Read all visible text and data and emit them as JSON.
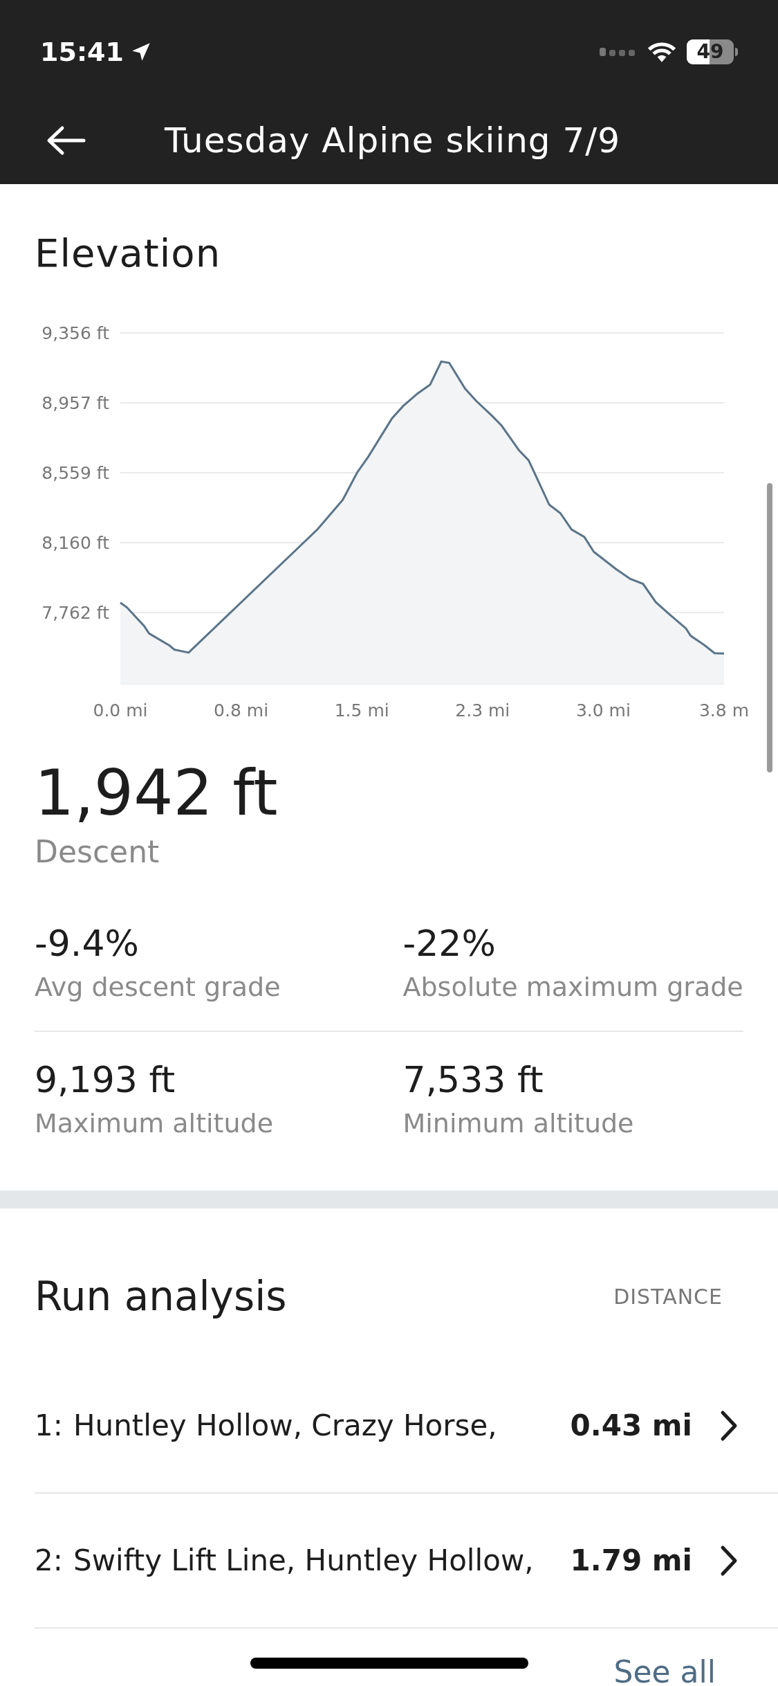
{
  "status_bar": {
    "time": "15:41",
    "battery": "49"
  },
  "header": {
    "title": "Tuesday Alpine skiing 7/9"
  },
  "elevation": {
    "title": "Elevation",
    "chart_data": {
      "type": "area",
      "xlim": [
        0,
        3.8
      ],
      "ylim": [
        7355,
        9356
      ],
      "x": [
        0,
        0.04,
        0.15,
        0.18,
        0.31,
        0.34,
        0.43,
        1.24,
        1.4,
        1.49,
        1.56,
        1.71,
        1.78,
        1.87,
        1.95,
        2.02,
        2.07,
        2.17,
        2.24,
        2.34,
        2.4,
        2.51,
        2.57,
        2.7,
        2.77,
        2.84,
        2.92,
        2.98,
        3.12,
        3.21,
        3.29,
        3.37,
        3.45,
        3.56,
        3.59,
        3.68,
        3.74,
        3.8
      ],
      "grid": true,
      "series": [
        {
          "color": "#5a7489",
          "values": [
            7818,
            7792,
            7685,
            7643,
            7573,
            7550,
            7533,
            8235,
            8404,
            8559,
            8649,
            8869,
            8939,
            9010,
            9061,
            9193,
            9185,
            9038,
            8968,
            8883,
            8827,
            8686,
            8629,
            8376,
            8328,
            8235,
            8193,
            8108,
            8009,
            7953,
            7925,
            7821,
            7756,
            7671,
            7629,
            7573,
            7530,
            7528
          ]
        }
      ],
      "yticks": [
        {
          "value": 9356,
          "label": "9,356 ft"
        },
        {
          "value": 8957,
          "label": "8,957 ft"
        },
        {
          "value": 8559,
          "label": "8,559 ft"
        },
        {
          "value": 8160,
          "label": "8,160 ft"
        },
        {
          "value": 7762,
          "label": "7,762 ft"
        }
      ],
      "xticks": [
        {
          "value": 0,
          "label": "0.0 mi"
        },
        {
          "value": 0.76,
          "label": "0.8 mi"
        },
        {
          "value": 1.52,
          "label": "1.5 mi"
        },
        {
          "value": 2.28,
          "label": "2.3 mi"
        },
        {
          "value": 3.04,
          "label": "3.0 mi"
        },
        {
          "value": 3.8,
          "label": "3.8 m"
        }
      ]
    }
  },
  "descent": {
    "value": "1,942 ft",
    "label": "Descent"
  },
  "stats": [
    {
      "value": "-9.4%",
      "label": "Avg descent grade"
    },
    {
      "value": "-22%",
      "label": "Absolute maximum grade"
    },
    {
      "value": "9,193 ft",
      "label": "Maximum altitude"
    },
    {
      "value": "7,533 ft",
      "label": "Minimum altitude"
    }
  ],
  "run_analysis": {
    "title": "Run analysis",
    "column_label": "DISTANCE",
    "runs": [
      {
        "index": "1:",
        "name": "Huntley Hollow, Crazy Horse,",
        "distance": "0.43 mi"
      },
      {
        "index": "2:",
        "name": "Swifty Lift Line, Huntley Hollow,",
        "distance": "1.79 mi"
      }
    ],
    "see_all": "See all"
  }
}
